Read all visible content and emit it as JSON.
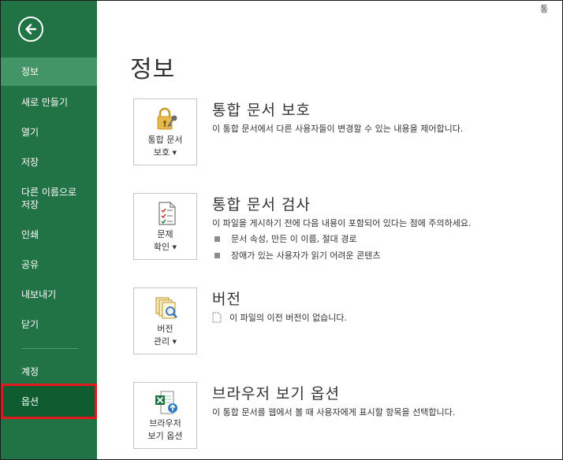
{
  "window": {
    "top_hint": "통"
  },
  "sidebar": {
    "items": [
      {
        "label": "정보"
      },
      {
        "label": "새로 만들기"
      },
      {
        "label": "열기"
      },
      {
        "label": "저장"
      },
      {
        "label": "다른 이름으로\n저장"
      },
      {
        "label": "인쇄"
      },
      {
        "label": "공유"
      },
      {
        "label": "내보내기"
      },
      {
        "label": "닫기"
      },
      {
        "label": "계정"
      },
      {
        "label": "옵션"
      }
    ]
  },
  "main": {
    "title": "정보",
    "sections": [
      {
        "tile_label": "통합 문서\n보호",
        "title": "통합 문서 보호",
        "description": "이 통합 문서에서 다른 사용자들이 변경할 수 있는 내용을 제어합니다."
      },
      {
        "tile_label": "문제\n확인",
        "title": "통합 문서 검사",
        "description": "이 파일을 게시하기 전에 다음 내용이 포함되어 있다는 점에 주의하세요.",
        "bullets": [
          "문서 속성, 만든 이 이름, 절대 경로",
          "장애가 있는 사용자가 읽기 어려운 콘텐츠"
        ]
      },
      {
        "tile_label": "버전\n관리",
        "title": "버전",
        "bullets": [
          "이 파일의 이전 버전이 없습니다."
        ]
      },
      {
        "tile_label": "브라우저\n보기 옵션",
        "title": "브라우저 보기 옵션",
        "description": "이 통합 문서를 웹에서 볼 때 사용자에게 표시할 항목을 선택합니다."
      }
    ]
  },
  "colors": {
    "sidebar_bg": "#217346",
    "active_item_bg": "#439467",
    "selected_item_bg": "#0e5c2f",
    "highlight_border": "#e3181e"
  }
}
